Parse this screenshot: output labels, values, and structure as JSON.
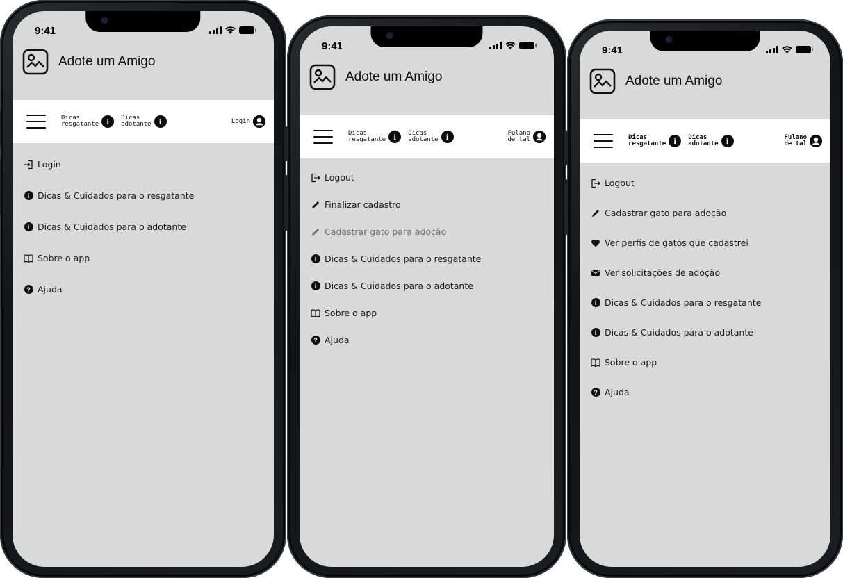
{
  "app": {
    "title": "Adote um Amigo"
  },
  "status": {
    "time": "9:41"
  },
  "screens": [
    {
      "nav": {
        "tip1": "Dicas\nresgatante",
        "tip2": "Dicas\nadotante",
        "account": "Login"
      },
      "menu": [
        {
          "icon": "login-icon",
          "label": "Login"
        },
        {
          "icon": "info-icon",
          "label": "Dicas & Cuidados para o resgatante"
        },
        {
          "icon": "info-icon",
          "label": "Dicas & Cuidados para o adotante"
        },
        {
          "icon": "book-icon",
          "label": "Sobre o app"
        },
        {
          "icon": "help-icon",
          "label": "Ajuda"
        }
      ]
    },
    {
      "nav": {
        "tip1": "Dicas\nresgatante",
        "tip2": "Dicas\nadotante",
        "account": "Fulano\nde tal"
      },
      "menu": [
        {
          "icon": "logout-icon",
          "label": "Logout"
        },
        {
          "icon": "pencil-icon",
          "label": "Finalizar cadastro"
        },
        {
          "icon": "pencil-icon",
          "label": "Cadastrar gato para adoção",
          "disabled": true
        },
        {
          "icon": "info-icon",
          "label": "Dicas & Cuidados para o resgatante"
        },
        {
          "icon": "info-icon",
          "label": "Dicas & Cuidados para o adotante"
        },
        {
          "icon": "book-icon",
          "label": "Sobre o app"
        },
        {
          "icon": "help-icon",
          "label": "Ajuda"
        }
      ]
    },
    {
      "nav": {
        "tip1": "Dicas\nresgatante",
        "tip2": "Dicas\nadotante",
        "account": "Fulano\nde tal"
      },
      "menu": [
        {
          "icon": "logout-icon",
          "label": "Logout"
        },
        {
          "icon": "pencil-icon",
          "label": "Cadastrar gato para adoção"
        },
        {
          "icon": "heart-icon",
          "label": "Ver perfis de gatos que cadastrei"
        },
        {
          "icon": "envelope-icon",
          "label": "Ver solicitações de adoção"
        },
        {
          "icon": "info-icon",
          "label": "Dicas & Cuidados para o resgatante"
        },
        {
          "icon": "info-icon",
          "label": "Dicas & Cuidados para o adotante"
        },
        {
          "icon": "book-icon",
          "label": "Sobre o app"
        },
        {
          "icon": "help-icon",
          "label": "Ajuda"
        }
      ]
    }
  ]
}
